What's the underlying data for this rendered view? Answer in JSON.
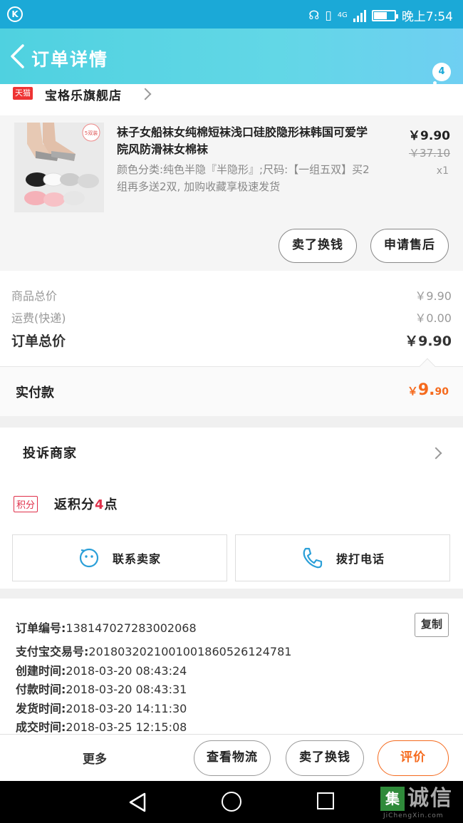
{
  "status_bar": {
    "network": "4G",
    "time": "晚上7:54",
    "left_icon": "K"
  },
  "header": {
    "title": "订单详情",
    "badge_count": "4"
  },
  "store": {
    "platform_tag": "天猫",
    "name": "宝格乐旗舰店"
  },
  "product": {
    "title": "袜子女船袜女纯棉短袜浅口硅胶隐形袜韩国可爱学院风防滑袜女棉袜",
    "sku": "颜色分类:纯色半隐『半隐形』;尺码:【一组五双】买2组再多送2双, 加购收藏享极速发货",
    "price": "￥9.90",
    "original_price": "￥37.10",
    "quantity": "x1",
    "thumb_badge": "5双装",
    "buttons": {
      "return_exchange": "卖了换钱",
      "after_sales": "申请售后"
    }
  },
  "summary": {
    "items_total_label": "商品总价",
    "items_total_value": "￥9.90",
    "shipping_label": "运费(快递)",
    "shipping_value": "￥0.00",
    "order_total_label": "订单总价",
    "order_total_value": "￥9.90",
    "paid_label": "实付款",
    "paid_currency": "￥",
    "paid_main": "9.",
    "paid_cents": "90"
  },
  "complaint": {
    "label": "投诉商家"
  },
  "points": {
    "tag": "积分",
    "prefix": "返积分",
    "value": "4",
    "suffix": "点"
  },
  "contact": {
    "seller_label": "联系卖家",
    "call_label": "拨打电话"
  },
  "order_info": {
    "order_no_label": "订单编号:",
    "order_no": "138147027283002068",
    "copy_label": "复制",
    "alipay_label": "支付宝交易号:",
    "alipay_no": "2018032021001001860526124781",
    "created_label": "创建时间:",
    "created": "2018-03-20 08:43:24",
    "paid_label": "付款时间:",
    "paid": "2018-03-20 08:43:31",
    "shipped_label": "发货时间:",
    "shipped": "2018-03-20 14:11:30",
    "completed_label": "成交时间:",
    "completed": "2018-03-25 12:15:08"
  },
  "actions": {
    "more": "更多",
    "logistics": "查看物流",
    "resell": "卖了换钱",
    "review": "评价"
  },
  "watermark": {
    "mark": "集",
    "text": "诚信",
    "sub": "JiChengXin.com"
  },
  "colors": {
    "header": "#5dd4e4",
    "status_bar": "#1ba9d7",
    "accent_orange": "#f56a1d",
    "points_red": "#e0304a"
  }
}
